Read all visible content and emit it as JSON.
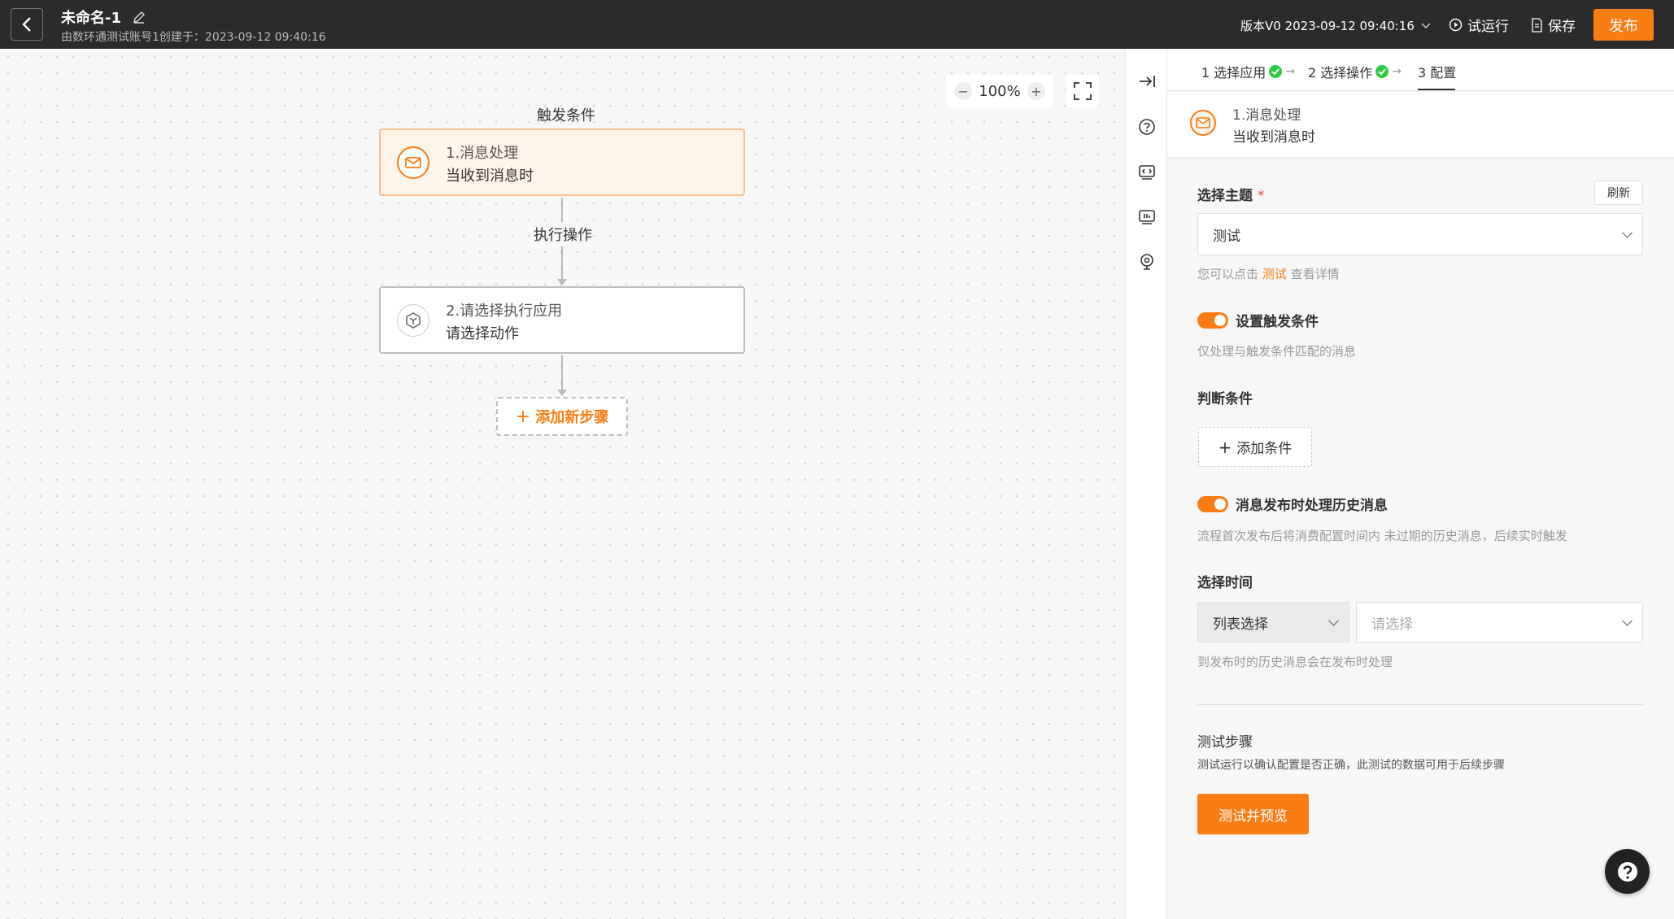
{
  "header": {
    "title": "未命名-1",
    "subtitle": "由数环通测试账号1创建于：2023-09-12 09:40:16",
    "version": "版本V0 2023-09-12 09:40:16",
    "trial_run": "试运行",
    "save": "保存",
    "publish": "发布"
  },
  "canvas": {
    "zoom": "100%",
    "zoom_minus": "−",
    "zoom_plus": "+",
    "trigger_label": "触发条件",
    "action_label": "执行操作",
    "node1": {
      "title": "1.消息处理",
      "subtitle": "当收到消息时"
    },
    "node2": {
      "title": "2.请选择执行应用",
      "subtitle": "请选择动作"
    },
    "add_step": "添加新步骤"
  },
  "panel": {
    "steps": [
      {
        "label": "1 选择应用",
        "done": true
      },
      {
        "label": "2 选择操作",
        "done": true
      },
      {
        "label": "3 配置",
        "done": false
      }
    ],
    "info": {
      "title": "1.消息处理",
      "subtitle": "当收到消息时"
    },
    "topic": {
      "label": "选择主题",
      "required_mark": "*",
      "refresh": "刷新",
      "value": "测试",
      "hint_prefix": "您可以点击",
      "hint_link": "测试",
      "hint_suffix": "查看详情"
    },
    "trigger_toggle": {
      "label": "设置触发条件",
      "on": true,
      "hint": "仅处理与触发条件匹配的消息"
    },
    "conditions": {
      "label": "判断条件",
      "add": "添加条件"
    },
    "history_toggle": {
      "label": "消息发布时处理历史消息",
      "on": true,
      "hint": "流程首次发布后将消费配置时间内 未过期的历史消息，后续实时触发"
    },
    "time": {
      "label": "选择时间",
      "mode": "列表选择",
      "placeholder": "请选择",
      "hint": "到发布时的历史消息会在发布时处理"
    },
    "test": {
      "title": "测试步骤",
      "desc": "测试运行以确认配置是否正确，此测试的数据可用于后续步骤",
      "button": "测试并预览"
    }
  },
  "colors": {
    "accent": "#fa7d14",
    "header_bg": "#2b2b2b",
    "success": "#2ecc40"
  }
}
